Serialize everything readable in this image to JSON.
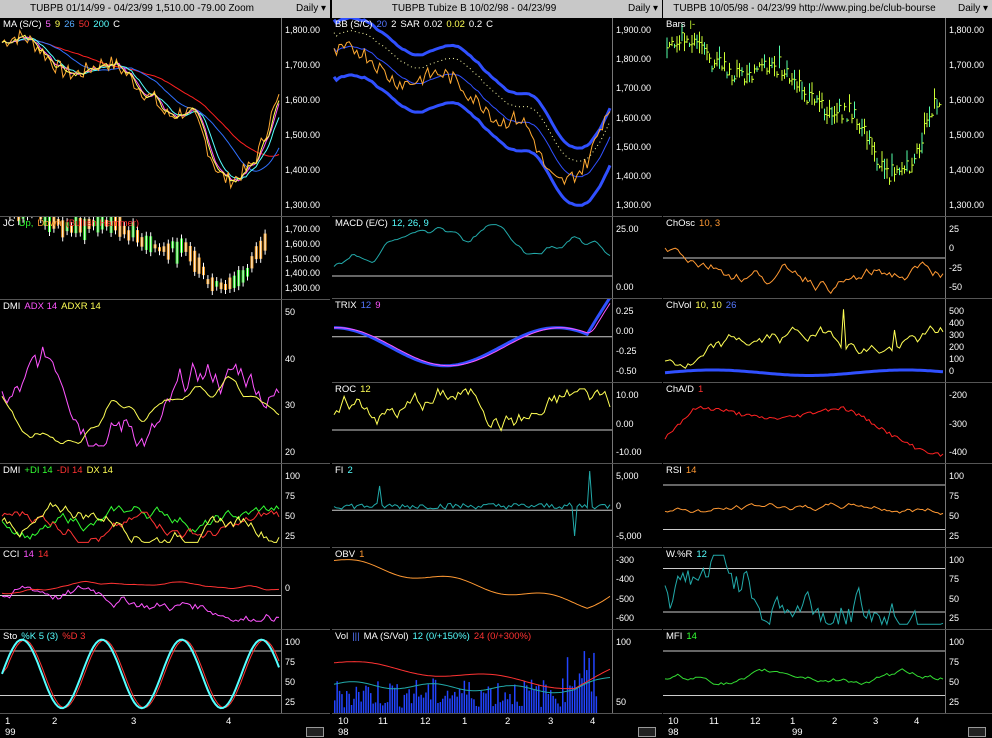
{
  "columns": [
    {
      "header": {
        "title": "TUBPB  01/14/99 - 04/23/99    1,510.00  -79.00    Zoom",
        "period": "Daily"
      },
      "x_labels": [
        "1",
        "2",
        "3",
        "4"
      ],
      "year_labels": [
        "99"
      ],
      "panels": [
        {
          "name": "ma",
          "label": [
            "MA (S/C)",
            "5",
            "9",
            "26",
            "50",
            "200",
            "C"
          ],
          "label_colors": [
            "#fff",
            "#ff66ff",
            "#ffff55",
            "#55aaff",
            "#ff3333",
            "#55ffff",
            "#fff"
          ],
          "ticks": [
            "1,800.00",
            "1,700.00",
            "1,600.00",
            "1,500.00",
            "1,400.00",
            "1,300.00"
          ]
        },
        {
          "name": "jc",
          "label": [
            "JC",
            "Up,",
            "Down",
            "(Bullish Hammer)"
          ],
          "label_colors": [
            "#fff",
            "#33ff33",
            "#ff9933",
            "#ff3333"
          ],
          "ticks": [
            "1,700.00",
            "1,600.00",
            "1,500.00",
            "1,400.00",
            "1,300.00"
          ]
        },
        {
          "name": "dmi-adx",
          "label": [
            "DMI",
            "ADX 14",
            "ADXR 14"
          ],
          "label_colors": [
            "#fff",
            "#ff55ff",
            "#ffff55"
          ],
          "ticks": [
            "50",
            "40",
            "30",
            "20"
          ]
        },
        {
          "name": "dmi-di",
          "label": [
            "DMI",
            "+DI 14",
            "-DI 14",
            "DX 14"
          ],
          "label_colors": [
            "#fff",
            "#33ff33",
            "#ff3333",
            "#ffff55"
          ],
          "ticks": [
            "100",
            "75",
            "50",
            "25"
          ]
        },
        {
          "name": "cci",
          "label": [
            "CCI",
            "14",
            "14"
          ],
          "label_colors": [
            "#fff",
            "#ff55ff",
            "#ff3333"
          ],
          "ticks": [
            "0"
          ]
        },
        {
          "name": "sto",
          "label": [
            "Sto",
            "%K 5 (3)",
            "%D 3"
          ],
          "label_colors": [
            "#fff",
            "#55ffff",
            "#ff3333"
          ],
          "ticks": [
            "100",
            "75",
            "50",
            "25"
          ]
        }
      ]
    },
    {
      "header": {
        "title": "TUBPB   Tubize B   10/02/98 - 04/23/99",
        "period": "Daily"
      },
      "x_labels": [
        "10",
        "11",
        "12",
        "1",
        "2",
        "3",
        "4"
      ],
      "year_labels": [
        "98"
      ],
      "panels": [
        {
          "name": "bb",
          "label": [
            "BB (S/C)",
            "20",
            "2",
            "SAR",
            "0.02",
            "0.02",
            "0.2",
            "C"
          ],
          "label_colors": [
            "#fff",
            "#5577ff",
            "#fff",
            "#fff",
            "#fff",
            "#ffff55",
            "#fff",
            "#fff"
          ],
          "ticks": [
            "1,900.00",
            "1,800.00",
            "1,700.00",
            "1,600.00",
            "1,500.00",
            "1,400.00",
            "1,300.00"
          ]
        },
        {
          "name": "macd",
          "label": [
            "MACD (E/C)",
            "12, 26, 9"
          ],
          "label_colors": [
            "#fff",
            "#55ffff"
          ],
          "ticks": [
            "25.00",
            "0.00"
          ]
        },
        {
          "name": "trix",
          "label": [
            "TRIX",
            "12",
            "9"
          ],
          "label_colors": [
            "#fff",
            "#5577ff",
            "#ff55ff"
          ],
          "ticks": [
            "0.25",
            "0.00",
            "-0.25",
            "-0.50"
          ]
        },
        {
          "name": "roc",
          "label": [
            "ROC",
            "12"
          ],
          "label_colors": [
            "#fff",
            "#ffff55"
          ],
          "ticks": [
            "10.00",
            "0.00",
            "-10.00"
          ]
        },
        {
          "name": "fi",
          "label": [
            "FI",
            "2"
          ],
          "label_colors": [
            "#fff",
            "#55ffff"
          ],
          "ticks": [
            "5,000",
            "0",
            "-5,000"
          ]
        },
        {
          "name": "obv",
          "label": [
            "OBV",
            "1"
          ],
          "label_colors": [
            "#fff",
            "#ff9933"
          ],
          "ticks": [
            "-300",
            "-400",
            "-500",
            "-600"
          ]
        },
        {
          "name": "vol",
          "label": [
            "Vol",
            "|||",
            "MA (S/Vol)",
            "12 (0/+150%)",
            "24 (0/+300%)"
          ],
          "label_colors": [
            "#fff",
            "#5577ff",
            "#fff",
            "#55ffff",
            "#ff3333"
          ],
          "ticks": [
            "100",
            "50"
          ]
        }
      ]
    },
    {
      "header": {
        "title": "TUBPB   10/05/98 - 04/23/99   http://www.ping.be/club-bourse",
        "period": "Daily"
      },
      "x_labels": [
        "10",
        "11",
        "12",
        "1",
        "2",
        "3",
        "4"
      ],
      "year_labels": [
        "98",
        "99"
      ],
      "panels": [
        {
          "name": "bars",
          "label": [
            "Bars",
            "|-"
          ],
          "label_colors": [
            "#fff",
            "#ccff33"
          ],
          "ticks": [
            "1,800.00",
            "1,700.00",
            "1,600.00",
            "1,500.00",
            "1,400.00",
            "1,300.00"
          ]
        },
        {
          "name": "chosc",
          "label": [
            "ChOsc",
            "10, 3"
          ],
          "label_colors": [
            "#fff",
            "#ff9933"
          ],
          "ticks": [
            "25",
            "0",
            "-25",
            "-50"
          ]
        },
        {
          "name": "chvol",
          "label": [
            "ChVol",
            "10, 10",
            "26"
          ],
          "label_colors": [
            "#fff",
            "#ffff55",
            "#5577ff"
          ],
          "ticks": [
            "500",
            "400",
            "300",
            "200",
            "100",
            "0"
          ]
        },
        {
          "name": "chad",
          "label": [
            "ChA/D",
            "1"
          ],
          "label_colors": [
            "#fff",
            "#ff3333"
          ],
          "ticks": [
            "-200",
            "-300",
            "-400"
          ]
        },
        {
          "name": "rsi",
          "label": [
            "RSI",
            "14"
          ],
          "label_colors": [
            "#fff",
            "#ff9933"
          ],
          "ticks": [
            "100",
            "75",
            "50",
            "25"
          ]
        },
        {
          "name": "wr",
          "label": [
            "W.%R",
            "12"
          ],
          "label_colors": [
            "#fff",
            "#55ffff"
          ],
          "ticks": [
            "100",
            "75",
            "50",
            "25"
          ]
        },
        {
          "name": "mfi",
          "label": [
            "MFI",
            "14"
          ],
          "label_colors": [
            "#fff",
            "#33ff33"
          ],
          "ticks": [
            "100",
            "75",
            "50",
            "25"
          ]
        }
      ]
    }
  ]
}
